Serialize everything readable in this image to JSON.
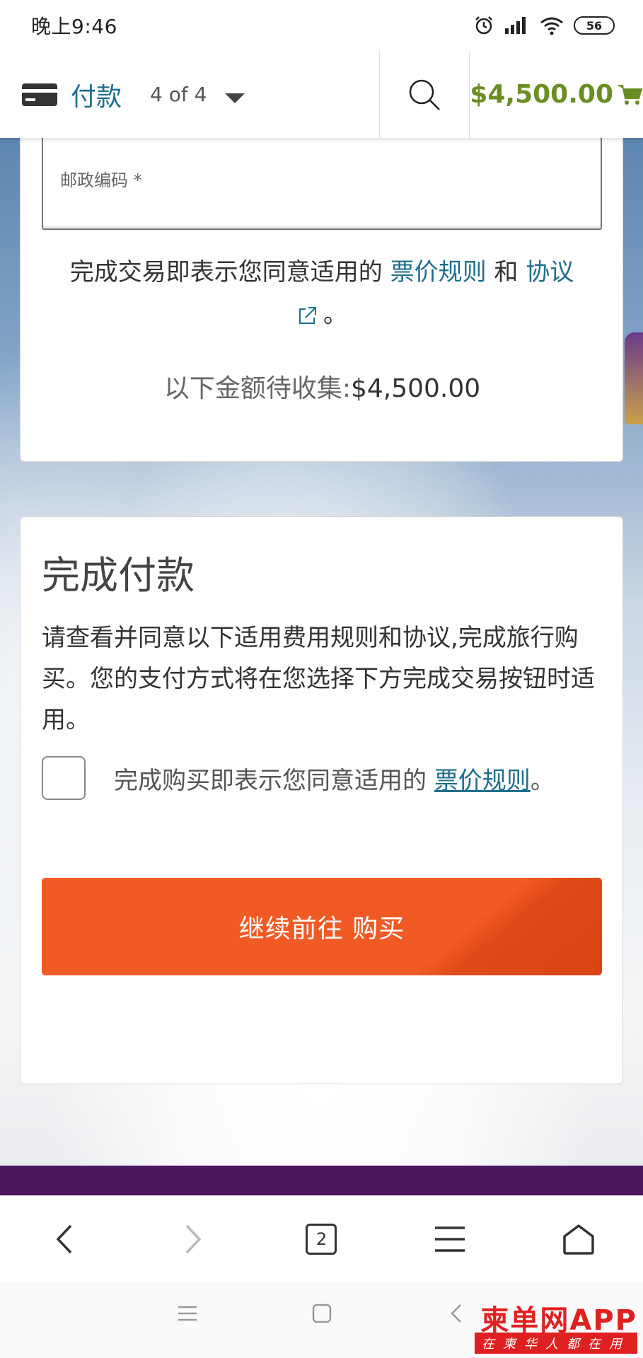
{
  "status_bar": {
    "time": "晚上9:46",
    "battery": "56"
  },
  "header": {
    "step_label": "付款",
    "step_count": "4 of 4",
    "cart_amount": "$4,500.00"
  },
  "payment_card": {
    "postal_label": "邮政编码 *",
    "agree_prefix": "完成交易即表示您同意适用的",
    "fare_rules_link": "票价规则",
    "and_text": "和",
    "agreement_link": "协议",
    "period": "。",
    "collect_label": "以下金额待收集:",
    "collect_amount": "$4,500.00"
  },
  "complete_card": {
    "title": "完成付款",
    "description": "请查看并同意以下适用费用规则和协议,完成旅行购买。您的支付方式将在您选择下方完成交易按钮时适用。",
    "consent_prefix": "完成购买即表示您同意适用的",
    "consent_link": "票价规则",
    "consent_suffix": "。",
    "buy_button": "继续前往 购买"
  },
  "browser_nav": {
    "tab_count": "2"
  },
  "watermark": {
    "main": "柬单网APP",
    "sub": "在柬华人都在用"
  },
  "colors": {
    "link": "#1f6e8c",
    "cart_green": "#6b8e23",
    "button_orange": "#f15a24",
    "footer_purple": "#4b1560"
  }
}
